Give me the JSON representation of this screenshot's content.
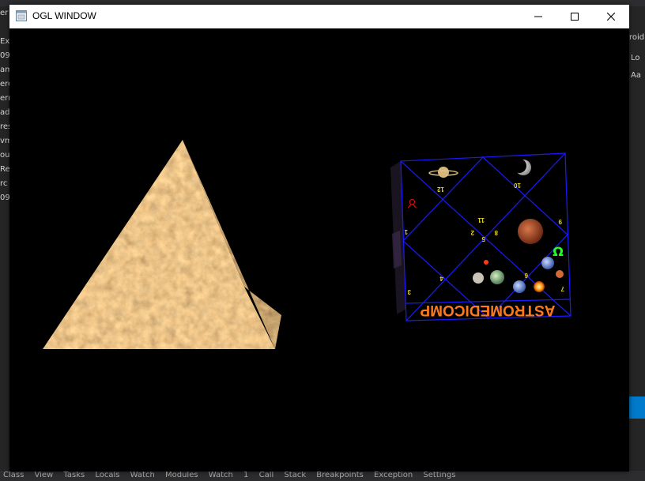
{
  "window": {
    "title": "OGL WINDOW",
    "minimize_icon": "minimize-icon",
    "maximize_icon": "maximize-icon",
    "close_icon": "close-icon"
  },
  "background_ide": {
    "left_panel_fragments": [
      "er",
      "",
      "Ex",
      "09_",
      "am",
      "ere",
      "ern",
      "ade",
      "res",
      "vm",
      "ou",
      "Re",
      "rc",
      "09_"
    ],
    "right_panel_fragments": [
      "roid)",
      "Lo",
      "Aa"
    ],
    "bottom_bar_text": "Class View   Tasks   Locals   Watch   Modules   Watch 1   Call Stack   Breakpoints   Exception Settings"
  },
  "scene": {
    "pyramid": {
      "texture": "rock-texture",
      "colors": [
        "#d9a05a",
        "#b87a3a",
        "#f0c88a"
      ]
    },
    "cube": {
      "banner": "ASTROMEDICOMP",
      "house_numbers": [
        "1",
        "2",
        "3",
        "4",
        "5",
        "6",
        "7",
        "8",
        "9",
        "10",
        "11",
        "12"
      ],
      "symbols": [
        "♉",
        "Ω"
      ],
      "line_color": "#1a1aff",
      "banner_color": "#ff7a1a",
      "number_color": "#e6d21e"
    }
  }
}
